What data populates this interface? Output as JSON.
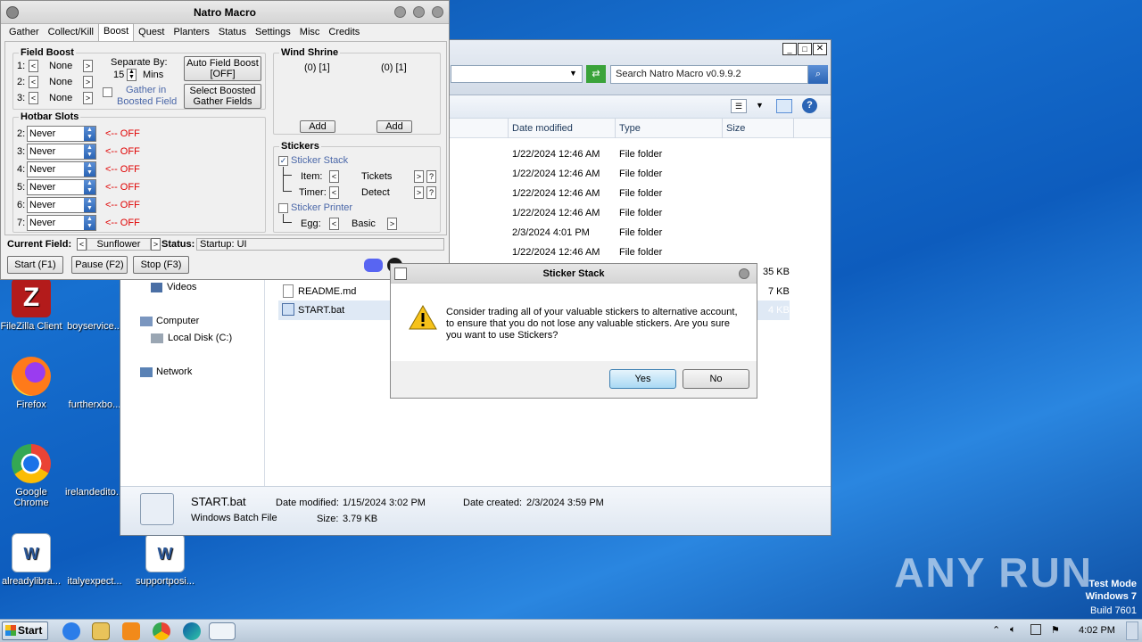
{
  "desktop": {
    "icons": [
      {
        "label": "FileZilla Client"
      },
      {
        "label": "boyservice..."
      },
      {
        "label": "Firefox"
      },
      {
        "label": "furtherxbo..."
      },
      {
        "label": "Google Chrome"
      },
      {
        "label": "irelandedito..."
      },
      {
        "label": "alreadylibra..."
      },
      {
        "label": "italyexpect..."
      },
      {
        "label": "supportposi..."
      }
    ],
    "watermark": "ANY RUN",
    "testmode": {
      "line1": "Test Mode",
      "line2": "Windows 7",
      "line3": "Build 7601"
    }
  },
  "explorer": {
    "search_placeholder": "Search Natro Macro v0.9.9.2",
    "columns": [
      "Date modified",
      "Type",
      "Size"
    ],
    "rows": [
      {
        "date": "1/22/2024 12:46 AM",
        "type": "File folder",
        "size": ""
      },
      {
        "date": "1/22/2024 12:46 AM",
        "type": "File folder",
        "size": ""
      },
      {
        "date": "1/22/2024 12:46 AM",
        "type": "File folder",
        "size": ""
      },
      {
        "date": "1/22/2024 12:46 AM",
        "type": "File folder",
        "size": ""
      },
      {
        "date": "2/3/2024 4:01 PM",
        "type": "File folder",
        "size": ""
      },
      {
        "date": "1/22/2024 12:46 AM",
        "type": "File folder",
        "size": ""
      }
    ],
    "files": [
      {
        "name": "",
        "size": "35 KB"
      },
      {
        "name": "README.md",
        "size": "7 KB"
      },
      {
        "name": "START.bat",
        "size": "4 KB"
      }
    ],
    "nav": {
      "videos": "Videos",
      "computer": "Computer",
      "local_disk": "Local Disk (C:)",
      "network": "Network"
    },
    "details": {
      "name": "START.bat",
      "type": "Windows Batch File",
      "modified_label": "Date modified:",
      "modified": "1/15/2024 3:02 PM",
      "size_label": "Size:",
      "size": "3.79 KB",
      "created_label": "Date created:",
      "created": "2/3/2024 3:59 PM"
    }
  },
  "natro": {
    "title": "Natro Macro",
    "tabs": [
      "Gather",
      "Collect/Kill",
      "Boost",
      "Quest",
      "Planters",
      "Status",
      "Settings",
      "Misc",
      "Credits"
    ],
    "field_boost": {
      "title": "Field Boost",
      "rows": [
        {
          "n": "1:",
          "value": "None"
        },
        {
          "n": "2:",
          "value": "None"
        },
        {
          "n": "3:",
          "value": "None"
        }
      ],
      "separate_label": "Separate By:",
      "separate_value": "15",
      "mins": "Mins",
      "gather_in_1": "Gather in",
      "gather_in_2": "Boosted Field",
      "auto_boost_1": "Auto Field Boost",
      "auto_boost_2": "[OFF]",
      "select_1": "Select Boosted",
      "select_2": "Gather Fields"
    },
    "hotbar": {
      "title": "Hotbar Slots",
      "slots": [
        {
          "n": "2:",
          "value": "Never",
          "status": "<-- OFF"
        },
        {
          "n": "3:",
          "value": "Never",
          "status": "<-- OFF"
        },
        {
          "n": "4:",
          "value": "Never",
          "status": "<-- OFF"
        },
        {
          "n": "5:",
          "value": "Never",
          "status": "<-- OFF"
        },
        {
          "n": "6:",
          "value": "Never",
          "status": "<-- OFF"
        },
        {
          "n": "7:",
          "value": "Never",
          "status": "<-- OFF"
        }
      ]
    },
    "wind_shrine": {
      "title": "Wind Shrine",
      "slot1": "(0) [1]",
      "slot2": "(0) [1]",
      "add": "Add"
    },
    "stickers": {
      "title": "Stickers",
      "stack": "Sticker Stack",
      "item_label": "Item:",
      "item_value": "Tickets",
      "timer_label": "Timer:",
      "timer_value": "Detect",
      "printer": "Sticker Printer",
      "egg_label": "Egg:",
      "egg_value": "Basic",
      "help": "?"
    },
    "current_field_label": "Current Field:",
    "current_field": "Sunflower",
    "status_label": "Status:",
    "status": "Startup: UI",
    "start": "Start (F1)",
    "pause": "Pause (F2)",
    "stop": "Stop (F3)"
  },
  "dialog": {
    "title": "Sticker Stack",
    "message": "Consider trading all of your valuable stickers to alternative account, to ensure that you do not lose any valuable stickers. Are you sure you want to use Stickers?",
    "yes": "Yes",
    "no": "No"
  },
  "taskbar": {
    "start": "Start",
    "time": "4:02 PM"
  }
}
